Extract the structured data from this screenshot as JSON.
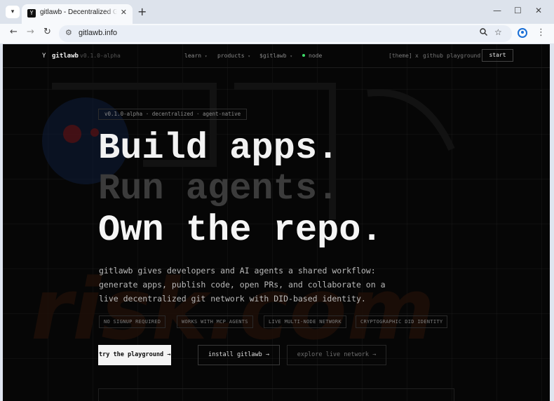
{
  "browser": {
    "tab_title": "gitlawb - Decentralized Git Net",
    "tab_favicon": "Y",
    "url": "gitlawb.info",
    "icons": {
      "tab_menu": "chevron-down-icon",
      "close_tab": "close-icon",
      "new_tab": "plus-icon",
      "back": "arrow-left-icon",
      "forward": "arrow-right-icon",
      "reload": "reload-icon",
      "site_info": "tune-icon",
      "zoom": "magnifier-icon",
      "bookmark": "star-icon",
      "profile": "profile-icon",
      "menu": "kebab-icon"
    }
  },
  "nav": {
    "logo": "Y",
    "brand": "gitlawb",
    "version": "v0.1.0-alpha",
    "menu": [
      {
        "label": "learn"
      },
      {
        "label": "products"
      },
      {
        "label": "$gitlawb"
      },
      {
        "label": "node"
      }
    ],
    "theme": "[theme]",
    "x": "x",
    "github": "github",
    "playground": "playground",
    "start": "start"
  },
  "hero": {
    "pill": "v0.1.0-alpha · decentralized · agent-native",
    "line1": "Build apps.",
    "line2": "Run agents.",
    "line3": "Own the repo.",
    "description": "gitlawb gives developers and AI agents a shared workflow: generate apps, publish code, open PRs, and collaborate on a live decentralized git network with DID-based identity.",
    "features": [
      "NO SIGNUP REQUIRED",
      "WORKS WITH MCP AGENTS",
      "LIVE MULTI-NODE NETWORK",
      "CRYPTOGRAPHIC DID IDENTITY"
    ],
    "cta_primary": "try the playground →",
    "cta_secondary": "install gitlawb →",
    "cta_tertiary": "explore live network →"
  },
  "colors": {
    "page_bg": "#060606",
    "accent_green": "#3ddc6a",
    "chrome_bg": "#dde3ec"
  }
}
